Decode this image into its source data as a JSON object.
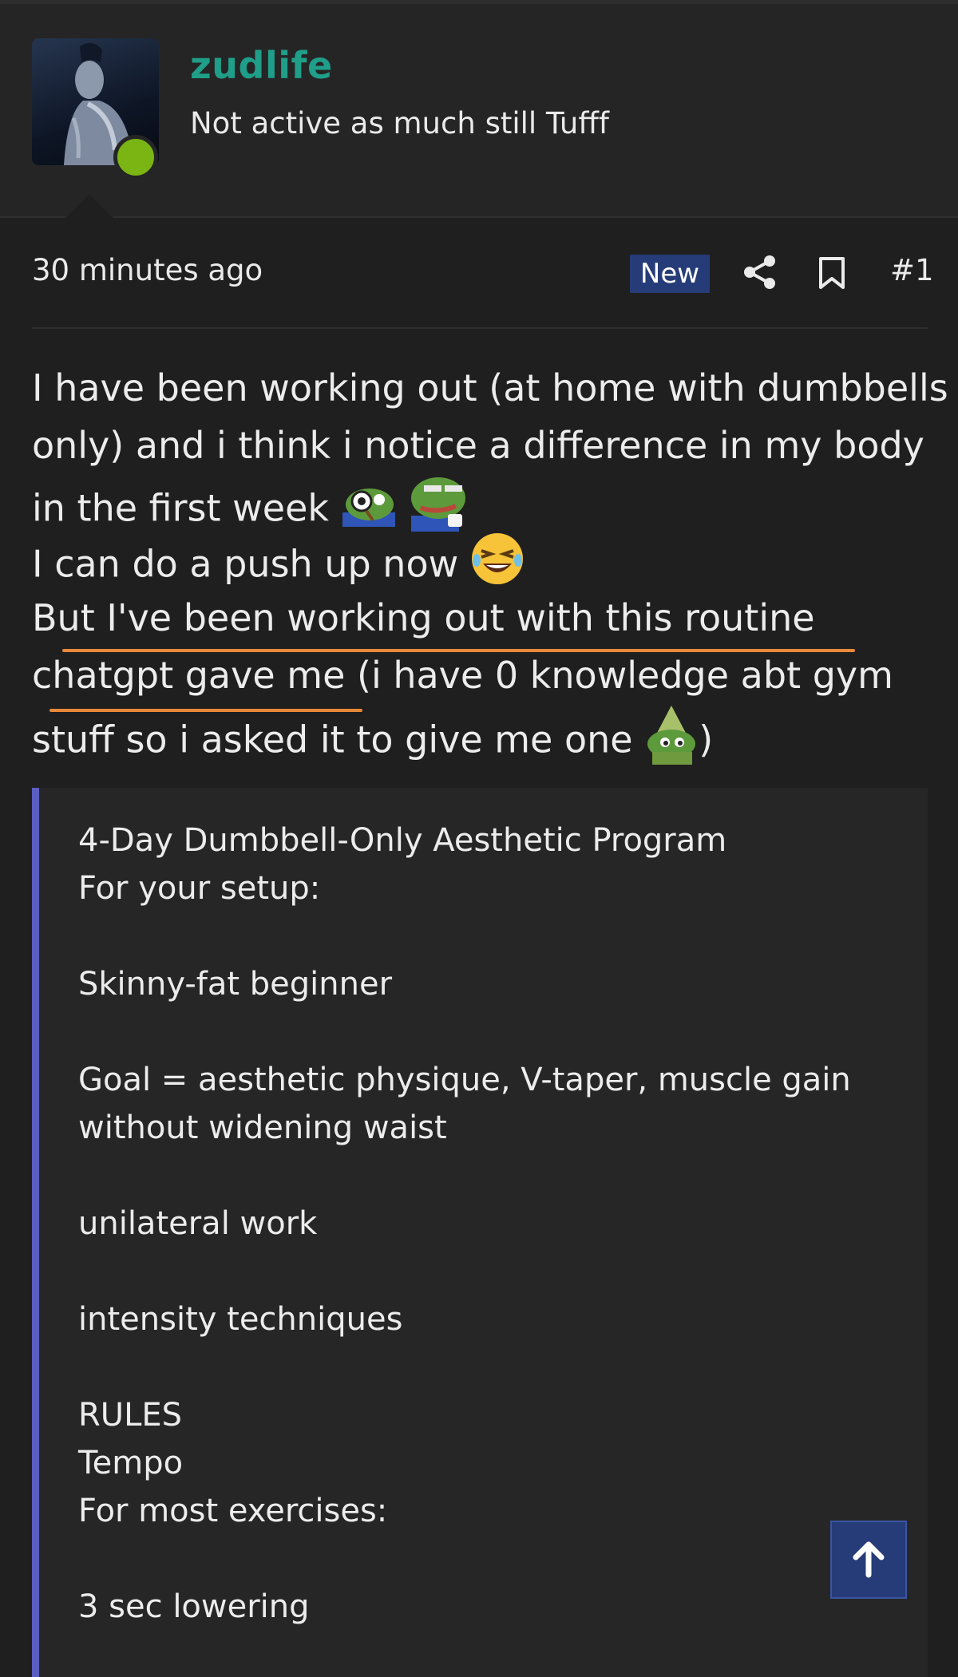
{
  "author": {
    "username": "zudlife",
    "user_title": "Not active as much still Tufff",
    "online_color": "#7ab514"
  },
  "meta": {
    "timestamp": "30 minutes ago",
    "new_badge": "New",
    "post_number": "#1",
    "share_icon": "share-icon",
    "bookmark_icon": "bookmark-icon"
  },
  "post": {
    "line1": "I have been working out (at home with dumbbells",
    "line2": "only) and i think i notice a difference in my body",
    "line3": "in the first week",
    "line4": "I can do a push up now",
    "line5": "But I've been working out with this routine",
    "line6": "chatgpt gave me (i have 0 knowledge abt gym",
    "line7a": "stuff so i asked it to give me one",
    "line7b": ")"
  },
  "quote": {
    "lines": [
      "4-Day Dumbbell-Only Aesthetic Program",
      "For your setup:",
      "",
      "Skinny-fat beginner",
      "",
      "Goal = aesthetic physique, V-taper, muscle gain",
      "without widening waist",
      "",
      "unilateral work",
      "",
      "intensity techniques",
      "",
      "RULES",
      "Tempo",
      "For most exercises:",
      "",
      "3 sec lowering"
    ]
  },
  "colors": {
    "username": "#1f9e89",
    "badge": "#263c78",
    "quote_bar": "#5a5ec1",
    "underline": "#e8893a"
  }
}
